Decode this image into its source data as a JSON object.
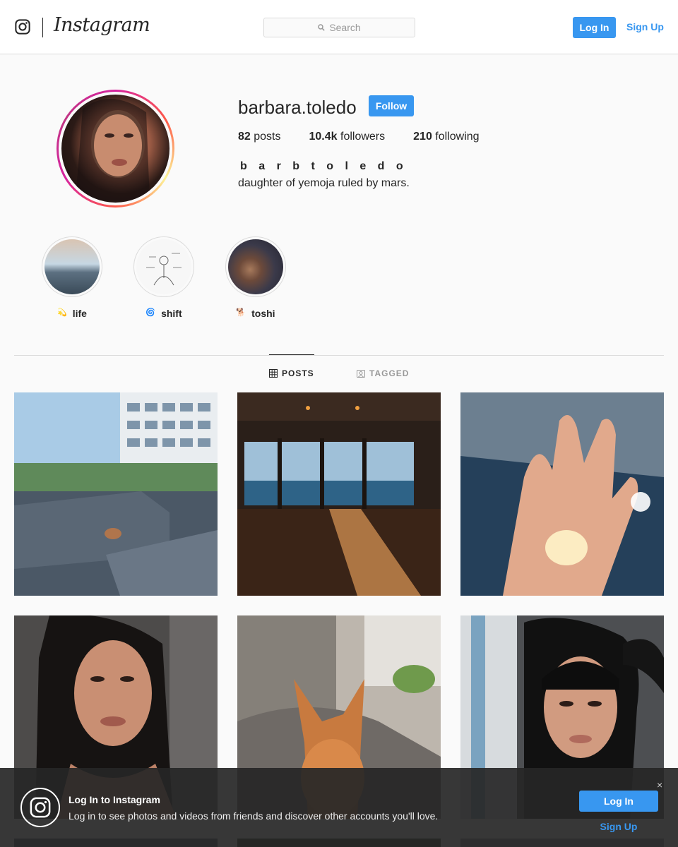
{
  "header": {
    "logo_text": "Instagram",
    "search_placeholder": "Search",
    "login_label": "Log In",
    "signup_label": "Sign Up"
  },
  "profile": {
    "username": "barbara.toledo",
    "follow_label": "Follow",
    "stats": {
      "posts_count": "82",
      "posts_label": "posts",
      "followers_count": "10.4k",
      "followers_label": "followers",
      "following_count": "210",
      "following_label": "following"
    },
    "full_name": "b a r b  t o l e d o",
    "bio": "daughter of yemoja ruled by mars."
  },
  "highlights": [
    {
      "emoji": "💫",
      "label": "life"
    },
    {
      "emoji": "🌀",
      "label": "shift"
    },
    {
      "emoji": "🐕",
      "label": "toshi"
    }
  ],
  "tabs": {
    "posts": "POSTS",
    "tagged": "TAGGED"
  },
  "colors": {
    "accent": "#3897f0",
    "text": "#262626",
    "muted": "#999999",
    "border": "#dbdbdb",
    "background": "#fafafa"
  },
  "banner": {
    "title": "Log In to Instagram",
    "text": "Log in to see photos and videos from friends and discover other accounts you'll love.",
    "close": "×",
    "login_label": "Log In",
    "signup_label": "Sign Up"
  }
}
